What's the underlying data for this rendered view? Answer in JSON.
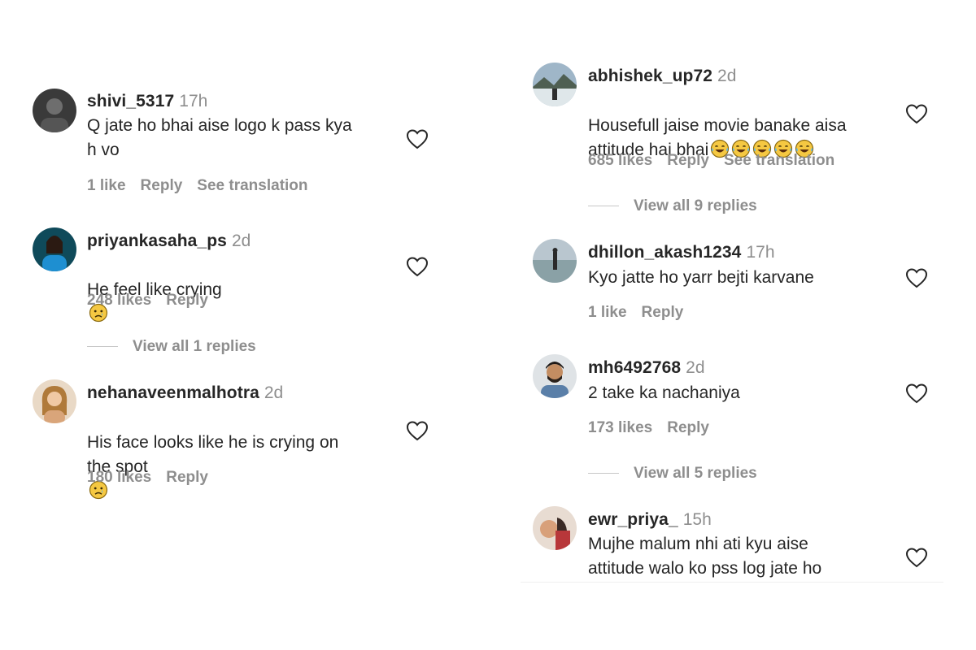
{
  "left_comments": [
    {
      "username": "shivi_5317",
      "time": "17h",
      "text": "Q jate ho bhai aise logo k pass kya\nh vo",
      "likes": "1 like",
      "reply": "Reply",
      "translation": "See translation"
    },
    {
      "username": "priyankasaha_ps",
      "time": "2d",
      "text": "He feel like crying",
      "emoji": "crying-face",
      "likes": "248 likes",
      "reply": "Reply",
      "view_replies": "View all 1 replies"
    },
    {
      "username": "nehanaveenmalhotra",
      "time": "2d",
      "text": "His face looks like he is crying on\nthe spot",
      "emoji": "crying-face",
      "likes": "180 likes",
      "reply": "Reply"
    }
  ],
  "right_comments": [
    {
      "username": "abhishek_up72",
      "time": "2d",
      "text": "Housefull jaise movie banake aisa\nattitude hai bhai",
      "emoji": "laughing-tears-x5",
      "likes": "685 likes",
      "reply": "Reply",
      "translation": "See translation",
      "view_replies": "View all 9 replies"
    },
    {
      "username": "dhillon_akash1234",
      "time": "17h",
      "text": "Kyo jatte ho yarr bejti karvane",
      "likes": "1 like",
      "reply": "Reply"
    },
    {
      "username": "mh6492768",
      "time": "2d",
      "text": "2 take ka nachaniya",
      "likes": "173 likes",
      "reply": "Reply",
      "view_replies": "View all 5 replies"
    },
    {
      "username": "ewr_priya_",
      "time": "15h",
      "text": "Mujhe malum nhi ati kyu aise\nattitude walo ko pss log jate ho"
    }
  ],
  "colors": {
    "text": "#262626",
    "muted": "#8e8e8e",
    "background": "#ffffff"
  },
  "icons": {
    "like": "heart-outline-icon",
    "sad": "crying-face-emoji",
    "laugh": "tears-of-joy-emoji"
  }
}
